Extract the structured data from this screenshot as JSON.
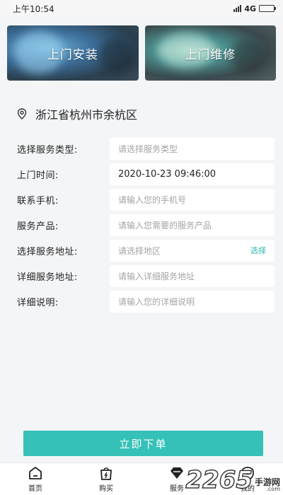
{
  "status_bar": {
    "time": "上午10:54",
    "network": "4G"
  },
  "banners": [
    {
      "label": "上门安装"
    },
    {
      "label": "上门维修"
    }
  ],
  "location": {
    "text": "浙江省杭州市余杭区",
    "icon": "location-pin-icon"
  },
  "form": {
    "service_type": {
      "label": "选择服务类型:",
      "placeholder": "请选择服务类型"
    },
    "visit_time": {
      "label": "上门时间:",
      "value": "2020-10-23 09:46:00"
    },
    "phone": {
      "label": "联系手机:",
      "placeholder": "请输入您的手机号"
    },
    "product": {
      "label": "服务产品:",
      "placeholder": "请输入您需要的服务产品"
    },
    "address_area": {
      "label": "选择服务地址:",
      "placeholder": "请选择地区",
      "select_label": "选择"
    },
    "address_detail": {
      "label": "详细服务地址:",
      "placeholder": "请输入详细服务地址"
    },
    "description": {
      "label": "详细说明:",
      "placeholder": "请输入您的详细说明"
    }
  },
  "submit_label": "立即下单",
  "tabbar": [
    {
      "label": "首页",
      "icon": "home-icon"
    },
    {
      "label": "购买",
      "icon": "shopping-bag-icon"
    },
    {
      "label": "服务",
      "icon": "diamond-icon"
    },
    {
      "label": "我的",
      "icon": "profile-icon"
    }
  ],
  "watermark": {
    "number": "2265",
    "cn": "手游网",
    "en": ".com"
  },
  "colors": {
    "accent": "#35c1b7",
    "link": "#2bb5b0",
    "background": "#f4f5f7"
  }
}
